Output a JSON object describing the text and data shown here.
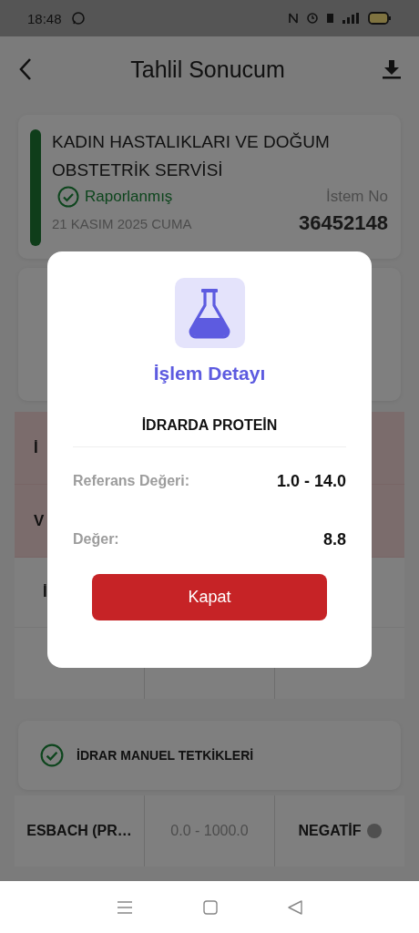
{
  "status_bar": {
    "time": "18:48"
  },
  "header": {
    "title": "Tahlil Sonucum"
  },
  "report": {
    "department": "KADIN HASTALIKLARI VE DOĞUM OBSTETRİK SERVİSİ",
    "status": "Raporlanmış",
    "date": "21 KASIM 2025 CUMA",
    "request_label": "İstem No",
    "request_no": "36452148"
  },
  "abnormal_rows": [
    {
      "label": "İ"
    },
    {
      "label": "V"
    }
  ],
  "normal_rows": [
    {
      "label": "İ"
    }
  ],
  "section": {
    "title": "İDRAR MANUEL TETKİKLERİ",
    "rows": [
      {
        "name": "ESBACH (PR…",
        "reference": "0.0 - 1000.0",
        "result": "NEGATİF",
        "color": "#4f4f4f"
      }
    ]
  },
  "dialog": {
    "title": "İşlem Detayı",
    "test": "İDRARDA PROTEİN",
    "fields": [
      {
        "label": "Referans Değeri:",
        "value": "1.0 - 14.0"
      },
      {
        "label": "Değer:",
        "value": "8.8"
      }
    ],
    "button": "Kapat"
  }
}
